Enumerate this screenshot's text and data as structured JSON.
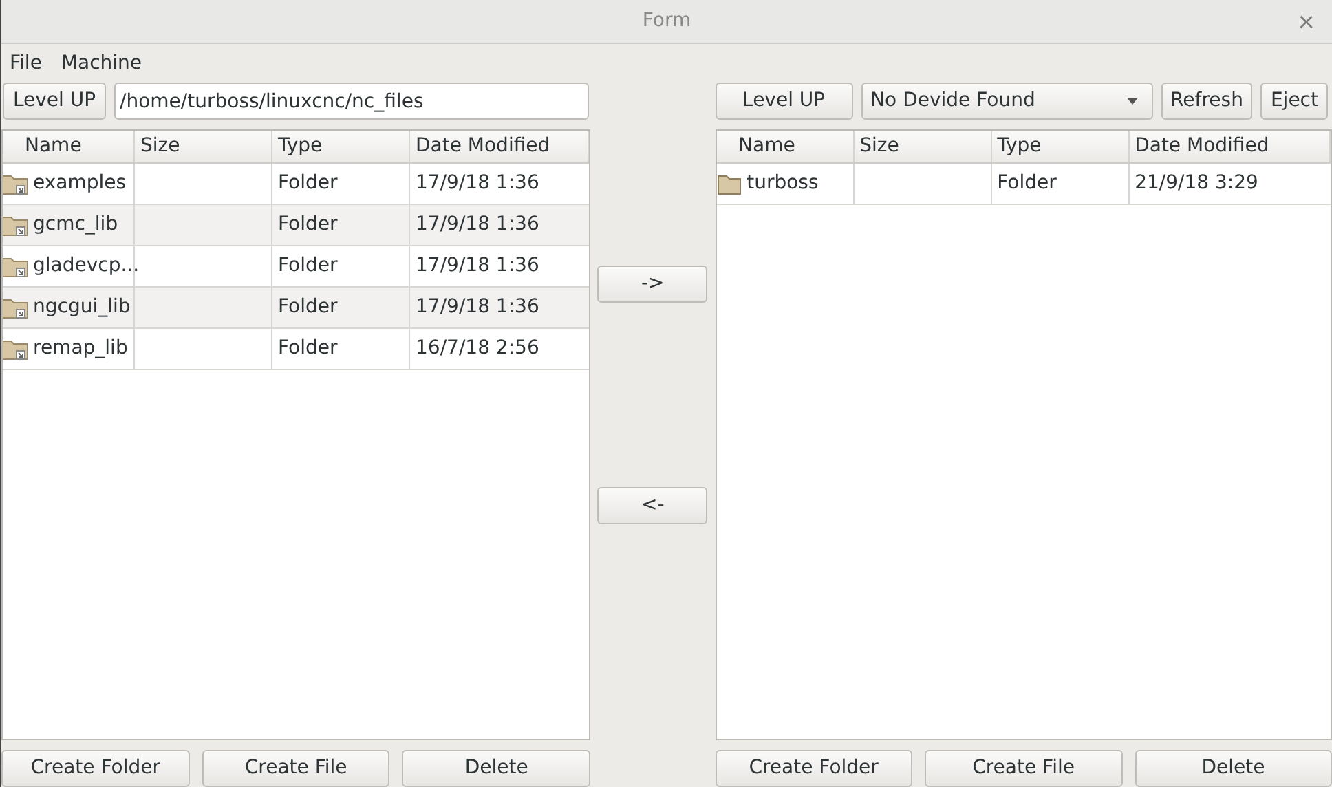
{
  "window": {
    "title": "Form",
    "close": "×"
  },
  "menu": [
    "File",
    "Machine"
  ],
  "left": {
    "level_up": "Level UP",
    "path": "/home/turboss/linuxcnc/nc_files",
    "columns": [
      "Name",
      "Size",
      "Type",
      "Date Modified"
    ],
    "rows": [
      {
        "kind": "link",
        "name": "examples",
        "type": "Folder",
        "date": "17/9/18 1:36"
      },
      {
        "kind": "link",
        "name": "gcmc_lib",
        "type": "Folder",
        "date": "17/9/18 1:36"
      },
      {
        "kind": "link",
        "name": "gladevcp...",
        "type": "Folder",
        "date": "17/9/18 1:36"
      },
      {
        "kind": "link",
        "name": "ngcgui_lib",
        "type": "Folder",
        "date": "17/9/18 1:36"
      },
      {
        "kind": "link",
        "name": "remap_lib",
        "type": "Folder",
        "date": "16/7/18 2:56"
      }
    ],
    "buttons": [
      "Create Folder",
      "Create File",
      "Delete"
    ]
  },
  "middle": {
    "buttons": [
      "->",
      "<-"
    ]
  },
  "right": {
    "level_up": "Level UP",
    "device": "No Devide Found",
    "refresh": "Refresh",
    "eject": "Eject",
    "columns": [
      "Name",
      "Size",
      "Type",
      "Date Modified"
    ],
    "rows": [
      {
        "kind": "folder",
        "name": "turboss",
        "type": "Folder",
        "date": "21/9/18 3:29"
      }
    ],
    "buttons": [
      "Create Folder",
      "Create File",
      "Delete"
    ]
  }
}
